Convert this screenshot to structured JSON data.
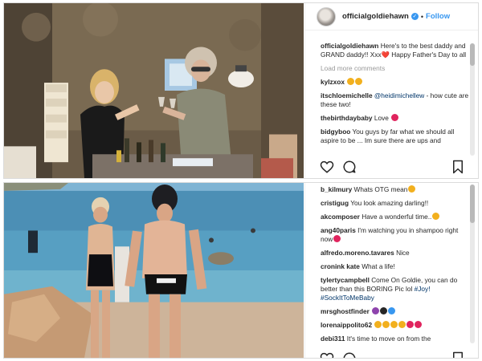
{
  "post1": {
    "username": "officialgoldiehawn",
    "follow_label": "Follow",
    "separator": "•",
    "caption": {
      "user": "officialgoldiehawn",
      "text": "Here's to the best daddy and GRAND daddy!! Xxx❤️ Happy Father's Day to all"
    },
    "load_more": "Load more comments",
    "comments": [
      {
        "user": "kylzxox",
        "text": "",
        "emojis": [
          "#f2b01e",
          "#f2b01e"
        ]
      },
      {
        "user": "itschloemichelle",
        "mention": "@heidimichellew",
        "text": " - how cute are these two!",
        "emojis": []
      },
      {
        "user": "thebirthdaybaby",
        "text": "Love ",
        "emojis": [
          "#e0245e"
        ]
      },
      {
        "user": "bidgyboo",
        "text": "You guys by far what we should all aspire to be ... Im sure there are ups and",
        "emojis": []
      }
    ]
  },
  "post2": {
    "comments": [
      {
        "user": "b_kilmury",
        "text": "Whats OTG mean",
        "emojis": [
          "#f2b01e"
        ]
      },
      {
        "user": "cristigug",
        "text": "You look amazing darling!!",
        "emojis": []
      },
      {
        "user": "akcomposer",
        "text": "Have a wonderful time..",
        "emojis": [
          "#f2b01e"
        ]
      },
      {
        "user": "ang40paris",
        "text": "I'm watching you in shampoo right now",
        "emojis": [
          "#e0245e"
        ]
      },
      {
        "user": "alfredo.moreno.tavares",
        "text": "Nice",
        "emojis": []
      },
      {
        "user": "cronink kate",
        "text": "What a life!",
        "emojis": []
      },
      {
        "user": "tylertycampbell",
        "text": "Come On Goldie, you can do better than this BORING Pic lol ",
        "hashtags": "#Joy! #SockItToMeBaby",
        "emojis": []
      },
      {
        "user": "mrsghostfinder",
        "text": "",
        "emojis": [
          "#8e44ad",
          "#262626",
          "#3897f0"
        ]
      },
      {
        "user": "lorenaippolito62",
        "text": "",
        "emojis": [
          "#f2b01e",
          "#f2b01e",
          "#f2b01e",
          "#f2b01e",
          "#e0245e",
          "#e0245e"
        ]
      },
      {
        "user": "debi311",
        "text": "It's time to move on from the",
        "emojis": []
      }
    ]
  },
  "colors": {
    "link": "#3897f0",
    "text": "#262626",
    "muted": "#999999"
  }
}
